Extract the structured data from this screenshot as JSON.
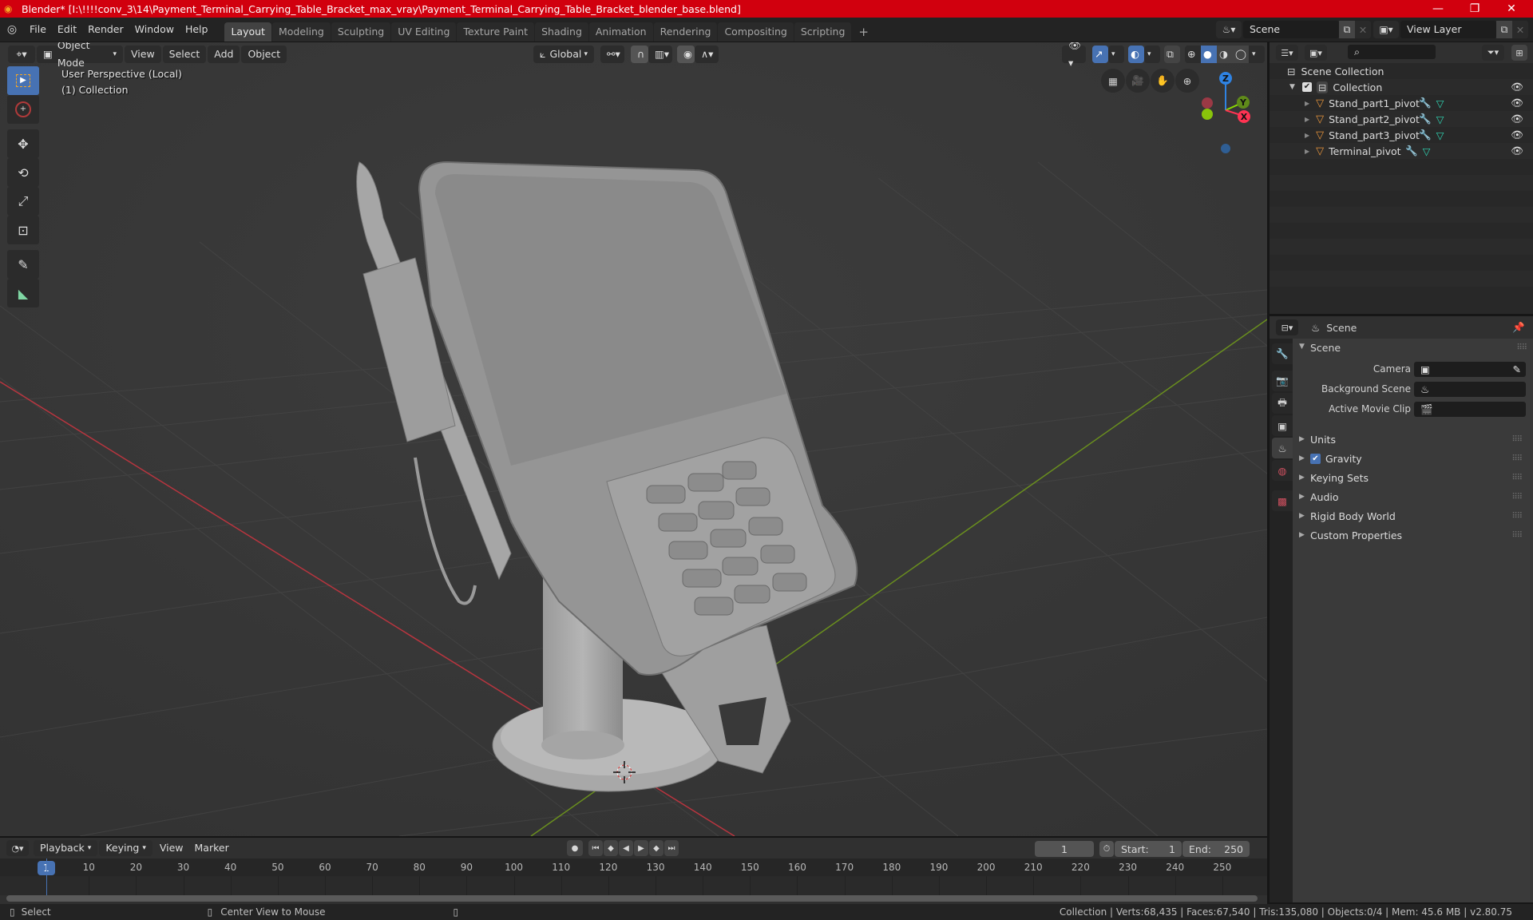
{
  "window": {
    "title": "Blender* [I:\\!!!!conv_3\\14\\Payment_Terminal_Carrying_Table_Bracket_max_vray\\Payment_Terminal_Carrying_Table_Bracket_blender_base.blend]",
    "controls": {
      "minimize": "—",
      "maximize": "❐",
      "close": "✕"
    }
  },
  "menu": [
    "File",
    "Edit",
    "Render",
    "Window",
    "Help"
  ],
  "workspaces": [
    "Layout",
    "Modeling",
    "Sculpting",
    "UV Editing",
    "Texture Paint",
    "Shading",
    "Animation",
    "Rendering",
    "Compositing",
    "Scripting"
  ],
  "active_workspace": "Layout",
  "add_workspace": "+",
  "scene_selector": {
    "value": "Scene"
  },
  "view_layer_selector": {
    "value": "View Layer"
  },
  "viewport": {
    "mode": "Object Mode",
    "menus": [
      "View",
      "Select",
      "Add",
      "Object"
    ],
    "transform_orientation": "Global",
    "overlay_line1": "User Perspective (Local)",
    "overlay_line2": "(1) Collection",
    "gizmo_axes": {
      "x": "X",
      "y": "Y",
      "z": "Z"
    },
    "colors": {
      "x_axis": "#ff3352",
      "y_axis": "#8bdc00",
      "z_axis": "#2f83e3",
      "accent": "#4772b3"
    },
    "tools": [
      "select-box",
      "cursor",
      "move",
      "rotate",
      "scale",
      "transform",
      "annotate",
      "measure"
    ],
    "nav_buttons": [
      "grid-toggle",
      "camera-view",
      "pan",
      "zoom"
    ],
    "shading_modes": [
      "wireframe",
      "solid",
      "material-preview",
      "rendered"
    ],
    "active_shading": "solid"
  },
  "outliner": {
    "root": "Scene Collection",
    "collection": {
      "name": "Collection",
      "checked": true
    },
    "objects": [
      {
        "name": "Stand_part1_pivot"
      },
      {
        "name": "Stand_part2_pivot"
      },
      {
        "name": "Stand_part3_pivot"
      },
      {
        "name": "Terminal_pivot"
      }
    ]
  },
  "properties": {
    "context": "Scene",
    "panel_title": "Scene",
    "fields": [
      {
        "label": "Camera",
        "value": ""
      },
      {
        "label": "Background Scene",
        "value": ""
      },
      {
        "label": "Active Movie Clip",
        "value": ""
      }
    ],
    "collapsed_panels": [
      {
        "label": "Units"
      },
      {
        "label": "Gravity",
        "checkbox": true
      },
      {
        "label": "Keying Sets"
      },
      {
        "label": "Audio"
      },
      {
        "label": "Rigid Body World"
      },
      {
        "label": "Custom Properties"
      }
    ]
  },
  "timeline": {
    "menus": [
      "Playback",
      "Keying",
      "View",
      "Marker"
    ],
    "current_frame": "1",
    "start_label": "Start:",
    "start": "1",
    "end_label": "End:",
    "end": "250",
    "ticks": [
      "10",
      "20",
      "30",
      "40",
      "50",
      "60",
      "70",
      "80",
      "90",
      "100",
      "110",
      "120",
      "130",
      "140",
      "150",
      "160",
      "170",
      "180",
      "190",
      "200",
      "210",
      "220",
      "230",
      "240",
      "250"
    ],
    "playhead": "1"
  },
  "statusbar": {
    "left_action": "Select",
    "middle_action": "Center View to Mouse",
    "stats": "Collection | Verts:68,435 | Faces:67,540 | Tris:135,080 | Objects:0/4 | Mem: 45.6 MB | v2.80.75"
  }
}
